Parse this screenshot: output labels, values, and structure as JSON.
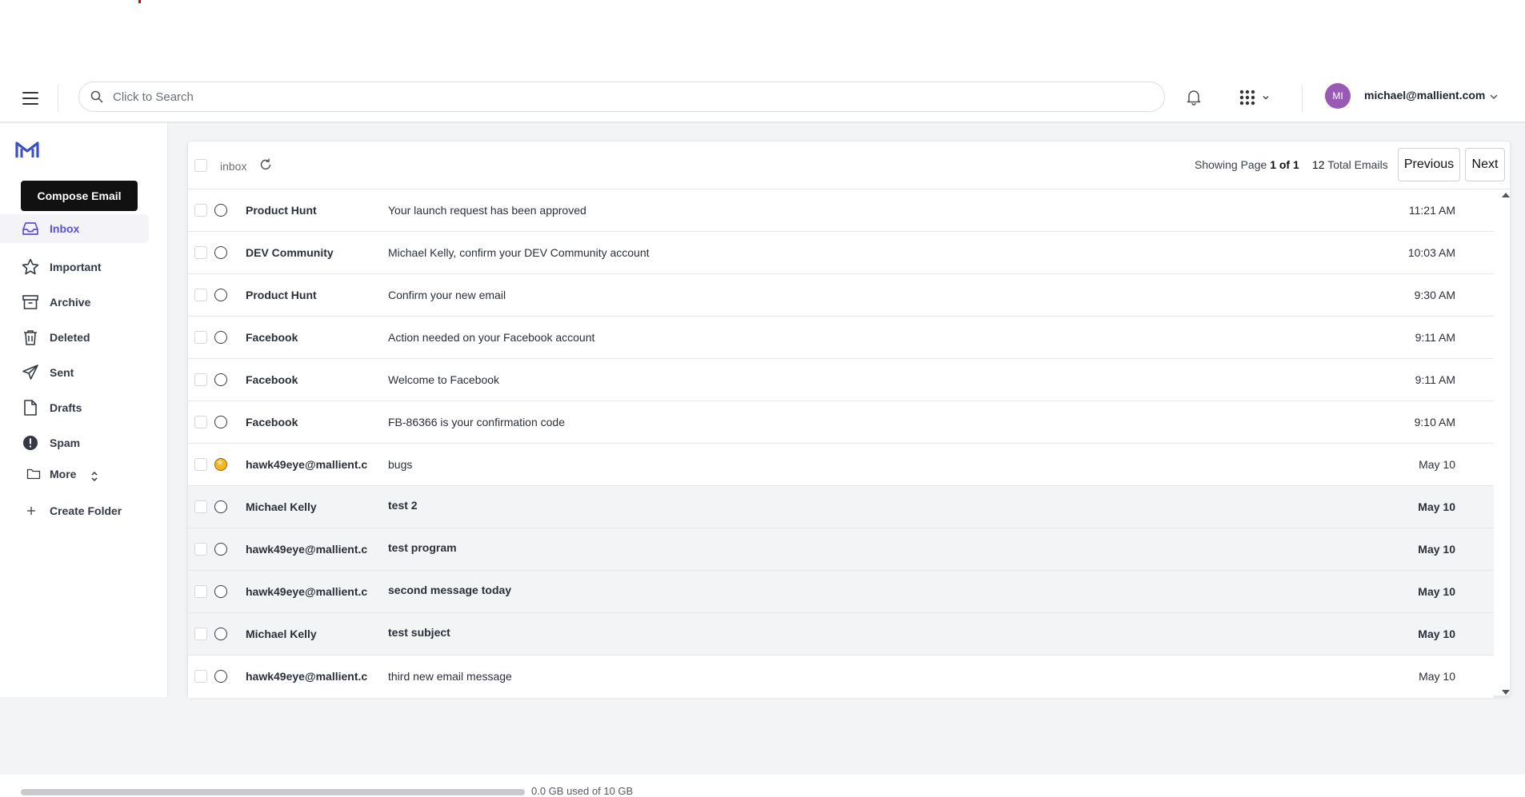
{
  "header": {
    "search_placeholder": "Click to Search",
    "avatar_initials": "MI",
    "user_email": "michael@mallient.com"
  },
  "sidebar": {
    "compose_label": "Compose Email",
    "items": [
      {
        "label": "Inbox",
        "icon": "inbox-icon"
      },
      {
        "label": "Important",
        "icon": "star-icon"
      },
      {
        "label": "Archive",
        "icon": "archive-icon"
      },
      {
        "label": "Deleted",
        "icon": "trash-icon"
      },
      {
        "label": "Sent",
        "icon": "send-icon"
      },
      {
        "label": "Drafts",
        "icon": "draft-icon"
      },
      {
        "label": "Spam",
        "icon": "spam-icon"
      }
    ],
    "more_label": "More",
    "create_folder_label": "Create Folder"
  },
  "toolbar": {
    "folder": "inbox",
    "page_prefix": "Showing Page ",
    "page_value": "1 of 1",
    "total_count": "12",
    "total_suffix": " Total Emails",
    "previous_label": "Previous",
    "next_label": "Next"
  },
  "emails": [
    {
      "sender": "Product Hunt",
      "subject": "Your launch request has been approved",
      "time": "11:21 AM"
    },
    {
      "sender": "DEV Community",
      "subject": "Michael Kelly, confirm your DEV Community account",
      "time": "10:03 AM"
    },
    {
      "sender": "Product Hunt",
      "subject": "Confirm your new email",
      "time": "9:30 AM"
    },
    {
      "sender": "Facebook",
      "subject": "Action needed on your Facebook account",
      "time": "9:11 AM"
    },
    {
      "sender": "Facebook",
      "subject": "Welcome to Facebook",
      "time": "9:11 AM"
    },
    {
      "sender": "Facebook",
      "subject": "FB-86366 is your confirmation code",
      "time": "9:10 AM"
    },
    {
      "sender": "hawk49eye@mallient.c",
      "subject": "bugs",
      "time": "May 10"
    },
    {
      "sender": "Michael Kelly",
      "subject": "test 2",
      "time": "May 10"
    },
    {
      "sender": "hawk49eye@mallient.c",
      "subject": "test program",
      "time": "May 10"
    },
    {
      "sender": "hawk49eye@mallient.c",
      "subject": "second message today",
      "time": "May 10"
    },
    {
      "sender": "Michael Kelly",
      "subject": "test subject",
      "time": "May 10"
    },
    {
      "sender": "hawk49eye@mallient.c",
      "subject": "third new email message",
      "time": "May 10"
    }
  ],
  "storage": {
    "text": "0.0 GB used of 10 GB",
    "used_fraction": 0.0
  },
  "colors": {
    "accent": "#5b50d6",
    "avatar": "#9b59b6",
    "compose_bg": "#111111",
    "star": "#f5b623"
  }
}
